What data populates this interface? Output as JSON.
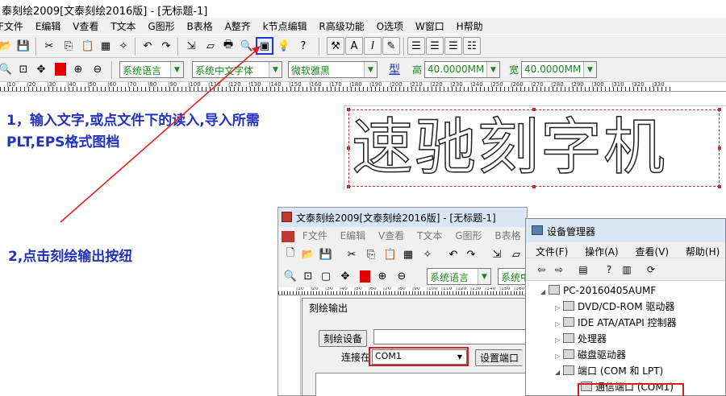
{
  "main_window": {
    "title": "泰刻绘2009[文泰刻绘2016版] - [无标题-1]",
    "menu": [
      "F文件",
      "E编辑",
      "V查看",
      "T文本",
      "G图形",
      "B表格",
      "A整齐",
      "k节点编辑",
      "R高级功能",
      "O选项",
      "W窗口",
      "H帮助"
    ],
    "toolbar2": {
      "language": "系统语言",
      "font_set": "系统中文字体",
      "font": "微软雅黑",
      "type_label": "型",
      "height_label": "高",
      "height_value": "40.0000MM",
      "width_label": "宽",
      "width_value": "40.0000MM"
    },
    "ruler_labels": [
      "|10",
      "|20",
      "|30",
      "|40",
      "|50",
      "|60",
      "|70",
      "|80",
      "|90",
      "|100",
      "|110",
      "|120",
      "|130",
      "|140",
      "|150",
      "|160",
      "|170",
      "|180",
      "|190",
      "|200",
      "|210",
      "|220",
      "|230",
      "|240",
      "|250",
      "|260",
      "|270",
      "|280",
      "|290",
      "|300",
      "|310",
      "|320",
      "|330"
    ],
    "canvas_text": "速驰刻字机"
  },
  "annotations": {
    "step1_line1": "1，输入文字,或点文件下的读入,导入所需",
    "step1_line2": "PLT,EPS格式图档",
    "step2": "2,点击刻绘输出按纽"
  },
  "second_window": {
    "title": "文泰刻绘2009[文泰刻绘2016版] - [无标题-1]",
    "menu": [
      "F文件",
      "E编辑",
      "V查看",
      "T文本",
      "G图形",
      "B表格"
    ],
    "language": "系统语言",
    "font_set_partial": "系统中",
    "ruler_labels": [
      "|10",
      "|20",
      "|30",
      "|40",
      "|50",
      "|60",
      "|70",
      "|80",
      "|90",
      "|100",
      "|110",
      "|120",
      "|130",
      "|140",
      "|150",
      "|160",
      "|170"
    ]
  },
  "output_dialog": {
    "title": "刻绘输出",
    "device_button": "刻绘设备",
    "device_value": "",
    "connect_label": "连接在",
    "port_value": "COM1",
    "set_port_button": "设置端口"
  },
  "device_manager": {
    "title": "设备管理器",
    "menu": [
      "文件(F)",
      "操作(A)",
      "查看(V)",
      "帮助(H)"
    ],
    "computer": "PC-20160405AUMF",
    "nodes": [
      "DVD/CD-ROM 驱动器",
      "IDE ATA/ATAPI 控制器",
      "处理器",
      "磁盘驱动器",
      "端口 (COM 和 LPT)",
      "通信端口 (COM1)"
    ]
  },
  "colors": {
    "annotation_blue": "#2233bb",
    "highlight_red": "#d02020",
    "arrow_red": "#e02020",
    "label_green": "#1a8a1a"
  }
}
